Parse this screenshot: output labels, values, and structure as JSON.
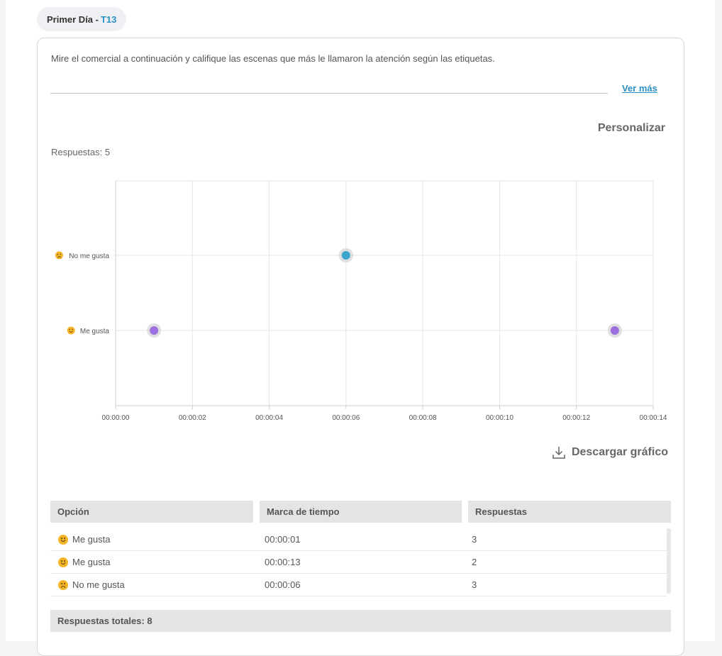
{
  "header": {
    "tab_title": "Primer Día -",
    "tab_code": "T13"
  },
  "question": {
    "text": "Mire el comercial a continuación y califique las escenas que más le llamaron la atención según las etiquetas.",
    "ver_mas": "Ver más"
  },
  "toolbar": {
    "personalizar": "Personalizar",
    "respuestas_label": "Respuestas: 5",
    "download_label": "Descargar gráfico"
  },
  "colors": {
    "accent": "#2a8fc4",
    "point_me_gusta": "#9b6fdd",
    "point_no_me_gusta": "#3aa6d0"
  },
  "chart_data": {
    "type": "scatter",
    "title": "",
    "xlabel": "",
    "ylabel": "",
    "x_ticks": [
      "00:00:00",
      "00:00:02",
      "00:00:04",
      "00:00:06",
      "00:00:08",
      "00:00:10",
      "00:00:12",
      "00:00:14"
    ],
    "xlim_seconds": [
      0,
      14
    ],
    "categories": [
      "Me gusta",
      "No me gusta"
    ],
    "points": [
      {
        "x_seconds": 1,
        "category": "Me gusta",
        "color": "#9b6fdd"
      },
      {
        "x_seconds": 6,
        "category": "No me gusta",
        "color": "#3aa6d0"
      },
      {
        "x_seconds": 13,
        "category": "Me gusta",
        "color": "#9b6fdd"
      }
    ],
    "grid": true
  },
  "table": {
    "headers": [
      "Opción",
      "Marca de tiempo",
      "Respuestas"
    ],
    "rows": [
      {
        "option": "Me gusta",
        "icon": "happy-emoji-icon",
        "timestamp": "00:00:01",
        "responses": "3"
      },
      {
        "option": "Me gusta",
        "icon": "happy-emoji-icon",
        "timestamp": "00:00:13",
        "responses": "2"
      },
      {
        "option": "No me gusta",
        "icon": "sad-emoji-icon",
        "timestamp": "00:00:06",
        "responses": "3"
      }
    ],
    "total": "Respuestas totales: 8"
  }
}
